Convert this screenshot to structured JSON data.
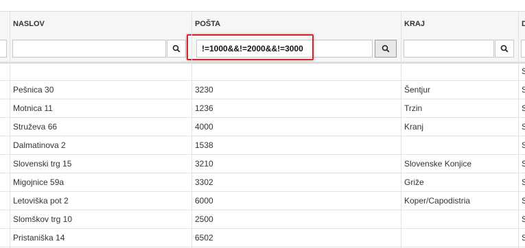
{
  "columns": {
    "naslov": "NASLOV",
    "posta": "POŠTA",
    "kraj": "KRAJ",
    "next": "D"
  },
  "filters": {
    "naslov": "",
    "posta": "!=1000&&!=2000&&!=3000",
    "kraj": ""
  },
  "rows": [
    {
      "naslov": "",
      "posta": "",
      "kraj": "",
      "next": "S"
    },
    {
      "naslov": "Pešnica 30",
      "posta": "3230",
      "kraj": "Šentjur",
      "next": "S"
    },
    {
      "naslov": "Motnica 11",
      "posta": "1236",
      "kraj": "Trzin",
      "next": "S"
    },
    {
      "naslov": "Struževa 66",
      "posta": "4000",
      "kraj": "Kranj",
      "next": "S"
    },
    {
      "naslov": "Dalmatinova 2",
      "posta": "1538",
      "kraj": "",
      "next": "S"
    },
    {
      "naslov": "Slovenski trg 15",
      "posta": "3210",
      "kraj": "Slovenske Konjice",
      "next": "S"
    },
    {
      "naslov": "Migojnice 59a",
      "posta": "3302",
      "kraj": "Griže",
      "next": "S"
    },
    {
      "naslov": "Letoviška pot 2",
      "posta": "6000",
      "kraj": "Koper/Capodistria",
      "next": "S"
    },
    {
      "naslov": "Slomškov trg 10",
      "posta": "2500",
      "kraj": "",
      "next": "S"
    },
    {
      "naslov": "Pristaniška 14",
      "posta": "6502",
      "kraj": "",
      "next": "S"
    }
  ],
  "colors": {
    "highlight": "#d9242b",
    "header_bg": "#f6f6f6",
    "grid_line": "#e2e2e2"
  }
}
